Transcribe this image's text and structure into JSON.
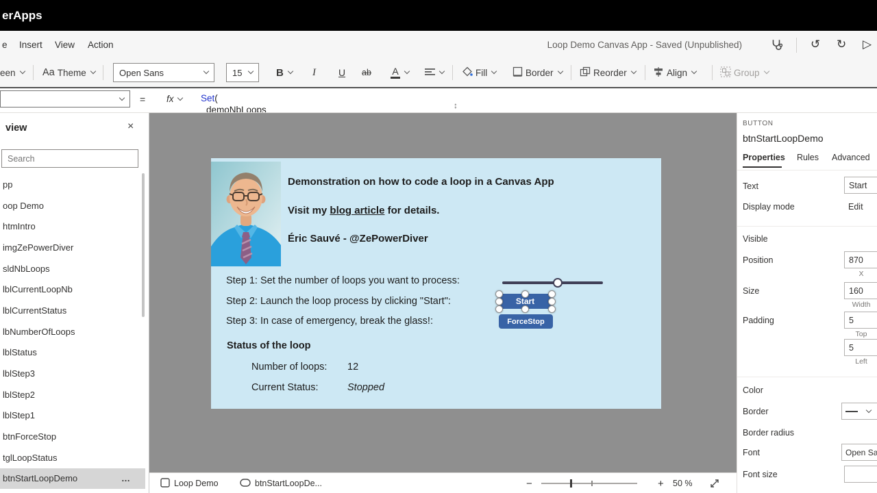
{
  "colors": {
    "topbar_bg": "#000000",
    "accent_button": "#3863a6",
    "app_screen_bg": "#cde8f4",
    "canvas_bg": "#8f8f8f",
    "formula_function": "#2033cc",
    "tab_underline": "#323130"
  },
  "icons": {
    "close": "×",
    "undo": "↺",
    "redo": "↻",
    "play": "▷",
    "overflow_menu": "…",
    "formula_resize": "↕"
  },
  "topbar": {
    "brand": "erApps"
  },
  "menubar": {
    "items": [
      {
        "label": "e"
      },
      {
        "label": "Insert"
      },
      {
        "label": "View"
      },
      {
        "label": "Action"
      }
    ],
    "title": "Loop Demo Canvas App - Saved (Unpublished)"
  },
  "ribbon": {
    "screen_dropdown": "een",
    "theme_icon": "Aa",
    "theme_label": "Theme",
    "font_name": "Open Sans",
    "font_size": "15",
    "bold": "B",
    "italic": "I",
    "underline": "U",
    "strikethrough": "ab",
    "font_color": "A",
    "fill_label": "Fill",
    "border_label": "Border",
    "reorder_label": "Reorder",
    "align_label": "Align",
    "group_label": "Group"
  },
  "formula_bar": {
    "equals": "=",
    "fx": "fx",
    "line1_function": "Set",
    "line1_paren": "(",
    "line2": "demoNbLoops"
  },
  "left_panel": {
    "title": "view",
    "search_placeholder": "Search",
    "items": [
      {
        "label": "pp"
      },
      {
        "label": "oop Demo"
      },
      {
        "label": "htmIntro"
      },
      {
        "label": "imgZePowerDiver"
      },
      {
        "label": "sldNbLoops"
      },
      {
        "label": "lblCurrentLoopNb"
      },
      {
        "label": "lblCurrentStatus"
      },
      {
        "label": "lbNumberOfLoops"
      },
      {
        "label": "lblStatus"
      },
      {
        "label": "lblStep3"
      },
      {
        "label": "lblStep2"
      },
      {
        "label": "lblStep1"
      },
      {
        "label": "btnForceStop"
      },
      {
        "label": "tglLoopStatus"
      },
      {
        "label": "btnStartLoopDemo"
      }
    ]
  },
  "canvas": {
    "app": {
      "heading1": "Demonstration on how to code a loop in a Canvas App",
      "line2_prefix": "Visit my ",
      "line2_link": "blog article",
      "line2_suffix": " for details.",
      "author": "Éric Sauvé - @ZePowerDiver",
      "step1": "Step 1: Set the number of loops you want to process:",
      "step2": "Step 2: Launch the loop process by clicking \"Start\":",
      "step3": "Step 3: In case of emergency, break the glass!:",
      "status_heading": "Status of the loop",
      "loops_label": "Number of loops:",
      "loops_value": "12",
      "status_label": "Current Status:",
      "status_value": "Stopped",
      "start_button": "Start",
      "forcestop_button": "ForceStop"
    }
  },
  "right_panel": {
    "control_type": "BUTTON",
    "control_name": "btnStartLoopDemo",
    "tabs": [
      {
        "label": "Properties"
      },
      {
        "label": "Rules"
      },
      {
        "label": "Advanced"
      }
    ],
    "rows": {
      "text_label": "Text",
      "text_value": "Start",
      "display_mode_label": "Display mode",
      "display_mode_value": "Edit",
      "visible_label": "Visible",
      "position_label": "Position",
      "position_value": "870",
      "position_sub": "X",
      "size_label": "Size",
      "size_value": "160",
      "size_sub": "Width",
      "padding_label": "Padding",
      "padding_top_value": "5",
      "padding_top_sub": "Top",
      "padding_left_value": "5",
      "padding_left_sub": "Left",
      "color_label": "Color",
      "border_label": "Border",
      "border_radius_label": "Border radius",
      "font_label": "Font",
      "font_value": "Open San",
      "font_size_label": "Font size"
    }
  },
  "bottom_bar": {
    "screen_name": "Loop Demo",
    "control_name": "btnStartLoopDe...",
    "zoom_out": "−",
    "zoom_in": "+",
    "zoom_value": "50 %"
  }
}
